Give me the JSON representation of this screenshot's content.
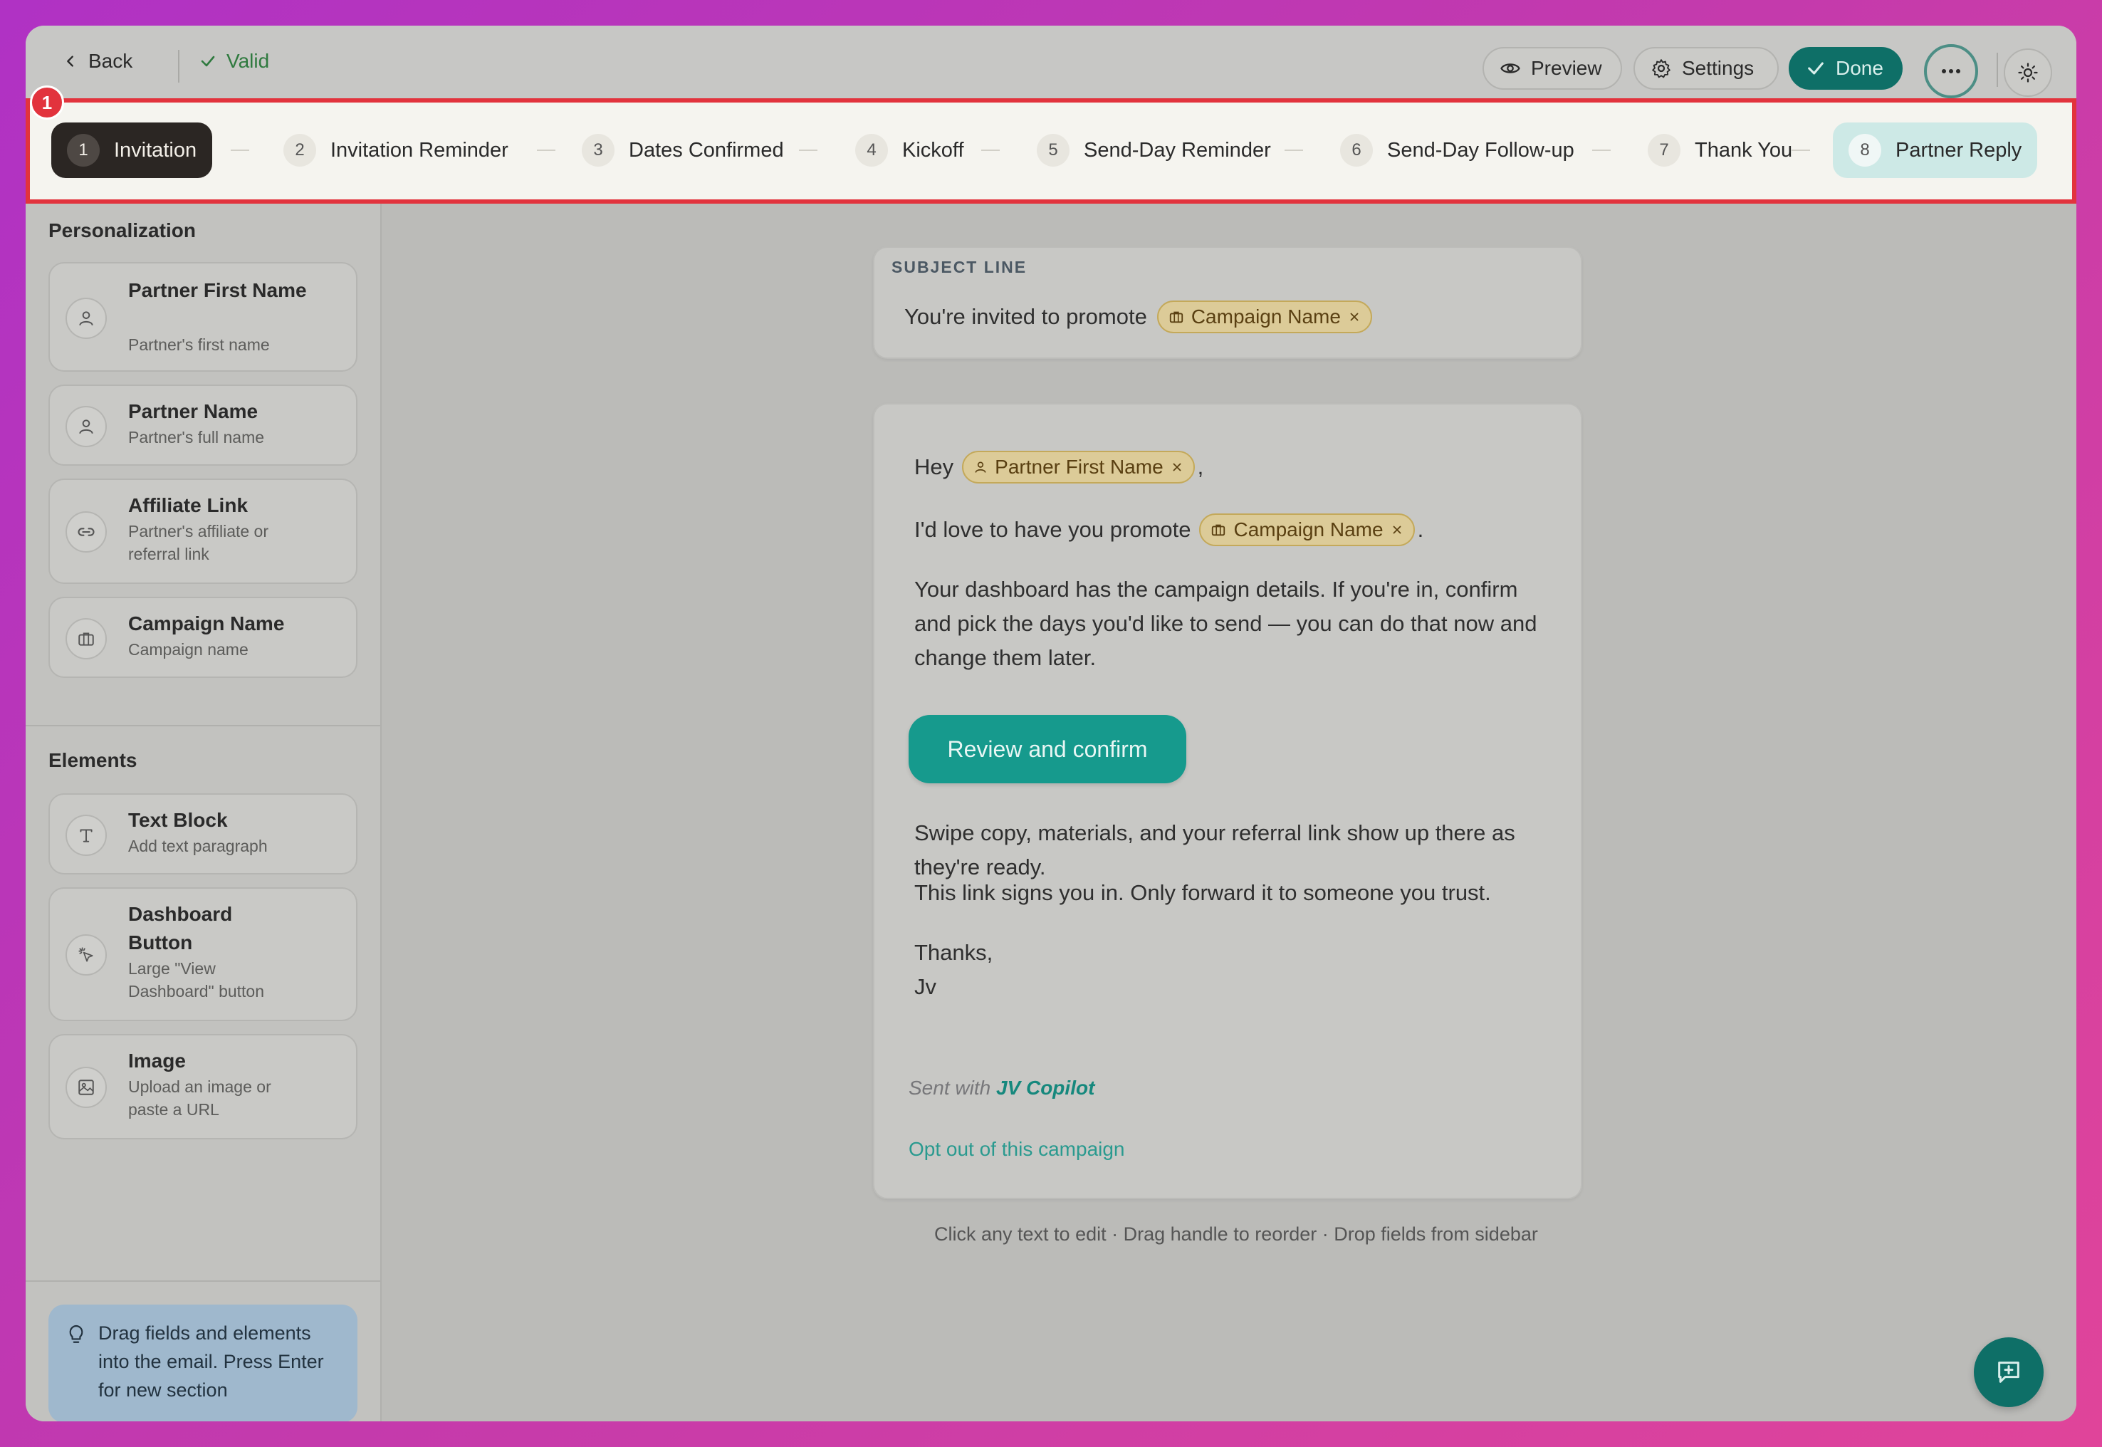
{
  "topbar": {
    "back_label": "Back",
    "valid_label": "Valid",
    "preview_label": "Preview",
    "settings_label": "Settings",
    "done_label": "Done"
  },
  "annotation_badge": "1",
  "steps": [
    {
      "num": "1",
      "label": "Invitation",
      "state": "active"
    },
    {
      "num": "2",
      "label": "Invitation Reminder"
    },
    {
      "num": "3",
      "label": "Dates Confirmed"
    },
    {
      "num": "4",
      "label": "Kickoff"
    },
    {
      "num": "5",
      "label": "Send-Day Reminder"
    },
    {
      "num": "6",
      "label": "Send-Day Follow-up"
    },
    {
      "num": "7",
      "label": "Thank You"
    },
    {
      "num": "8",
      "label": "Partner Reply",
      "state": "highlighted"
    }
  ],
  "sidebar": {
    "personalization_title": "Personalization",
    "fields": [
      {
        "title": "Partner First Name",
        "desc": "Partner's first name",
        "icon": "user-icon"
      },
      {
        "title": "Partner Name",
        "desc": "Partner's full name",
        "icon": "user-icon"
      },
      {
        "title": "Affiliate Link",
        "desc": "Partner's affiliate or referral link",
        "icon": "link-icon"
      },
      {
        "title": "Campaign Name",
        "desc": "Campaign name",
        "icon": "briefcase-icon"
      }
    ],
    "elements_title": "Elements",
    "elements": [
      {
        "title": "Text Block",
        "desc": "Add text paragraph",
        "icon": "text-icon"
      },
      {
        "title": "Dashboard Button",
        "desc": "Large \"View Dashboard\" button",
        "icon": "pointer-click-icon"
      },
      {
        "title": "Image",
        "desc": "Upload an image or paste a URL",
        "icon": "image-icon"
      }
    ],
    "tip": "Drag fields and elements into the email. Press Enter for new section"
  },
  "email": {
    "subject_label": "SUBJECT LINE",
    "subject_text": "You're invited to promote",
    "subject_chip": "Campaign Name",
    "greeting": "Hey",
    "greeting_chip": "Partner First Name",
    "greeting_end": ",",
    "line2_text": "I'd love to have you promote",
    "line2_chip": "Campaign Name",
    "line2_end": ".",
    "para3": "Your dashboard has the campaign details. If you're in, confirm and pick the days you'd like to send — you can do that now and change them later.",
    "cta_label": "Review and confirm",
    "para4": "Swipe copy, materials, and your referral link show up there as they're ready.",
    "para5": "This link signs you in. Only forward it to someone you trust.",
    "signoff": "Thanks,",
    "signature": "Jv",
    "sent_with": "Sent with",
    "brand": "JV Copilot",
    "optout": "Opt out of this campaign"
  },
  "hint": "Click any text to edit · Drag handle to reorder · Drop fields from sidebar",
  "colors": {
    "accent": "#0e6f67",
    "chip_bg": "#dccb98",
    "highlight_outline": "#e2333d"
  }
}
